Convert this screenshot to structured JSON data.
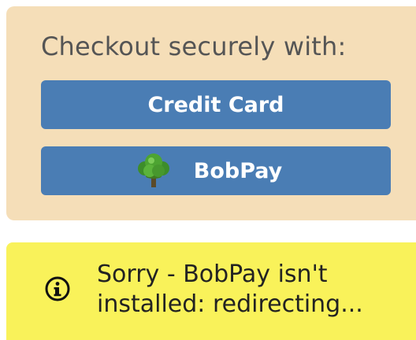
{
  "checkout": {
    "heading": "Checkout securely with:",
    "credit_card_label": "Credit Card",
    "bobpay_label": "BobPay",
    "bobpay_logo_icon": "tree-icon",
    "colors": {
      "panel_background": "#f5deb8",
      "button_background": "#4a7db4",
      "button_text": "#ffffff"
    }
  },
  "error_banner": {
    "icon": "info-icon",
    "message": "Sorry - BobPay isn't installed: redirecting...",
    "colors": {
      "background": "#f9f25a",
      "text": "#222222"
    }
  }
}
